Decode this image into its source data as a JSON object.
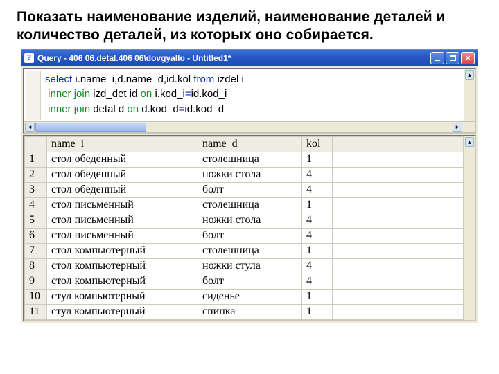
{
  "heading": "Показать наименование изделий, наименование деталей  и количество деталей, из которых оно собирается.",
  "window": {
    "title": "Query - 406 06.detal.406 06\\dovgyallo - Untitled1*",
    "app_icon_glyph": "?"
  },
  "sql": {
    "tokens": [
      {
        "t": "select",
        "c": "blue"
      },
      {
        "t": " i.name_i,d.name_d,id.kol ",
        "c": ""
      },
      {
        "t": "from",
        "c": "blue"
      },
      {
        "t": " izdel i",
        "c": ""
      },
      {
        "t": "\n ",
        "c": ""
      },
      {
        "t": "inner join",
        "c": "green"
      },
      {
        "t": " izd_det id ",
        "c": ""
      },
      {
        "t": "on",
        "c": "green"
      },
      {
        "t": " i.kod_i",
        "c": ""
      },
      {
        "t": "=",
        "c": "blue"
      },
      {
        "t": "id.kod_i",
        "c": ""
      },
      {
        "t": "\n ",
        "c": ""
      },
      {
        "t": "inner join",
        "c": "green"
      },
      {
        "t": " detal d ",
        "c": ""
      },
      {
        "t": "on",
        "c": "green"
      },
      {
        "t": " d.kod_d",
        "c": ""
      },
      {
        "t": "=",
        "c": "blue"
      },
      {
        "t": "id.kod_d",
        "c": ""
      }
    ]
  },
  "grid": {
    "columns": [
      "name_i",
      "name_d",
      "kol"
    ],
    "rows": [
      {
        "n": "1",
        "name_i": "стол обеденный",
        "name_d": "столешница",
        "kol": "1"
      },
      {
        "n": "2",
        "name_i": "стол обеденный",
        "name_d": "ножки стола",
        "kol": "4"
      },
      {
        "n": "3",
        "name_i": "стол обеденный",
        "name_d": "болт",
        "kol": "4"
      },
      {
        "n": "4",
        "name_i": "стол письменный",
        "name_d": "столешница",
        "kol": "1"
      },
      {
        "n": "5",
        "name_i": "стол письменный",
        "name_d": "ножки стола",
        "kol": "4"
      },
      {
        "n": "6",
        "name_i": "стол письменный",
        "name_d": "болт",
        "kol": "4"
      },
      {
        "n": "7",
        "name_i": "стол компьютерный",
        "name_d": "столешница",
        "kol": "1"
      },
      {
        "n": "8",
        "name_i": "стол компьютерный",
        "name_d": "ножки стула",
        "kol": "4"
      },
      {
        "n": "9",
        "name_i": "стол компьютерный",
        "name_d": "болт",
        "kol": "4"
      },
      {
        "n": "10",
        "name_i": "стул компьютерный",
        "name_d": "сиденье",
        "kol": "1"
      },
      {
        "n": "11",
        "name_i": "стул компьютерный",
        "name_d": "спинка",
        "kol": "1"
      }
    ]
  }
}
